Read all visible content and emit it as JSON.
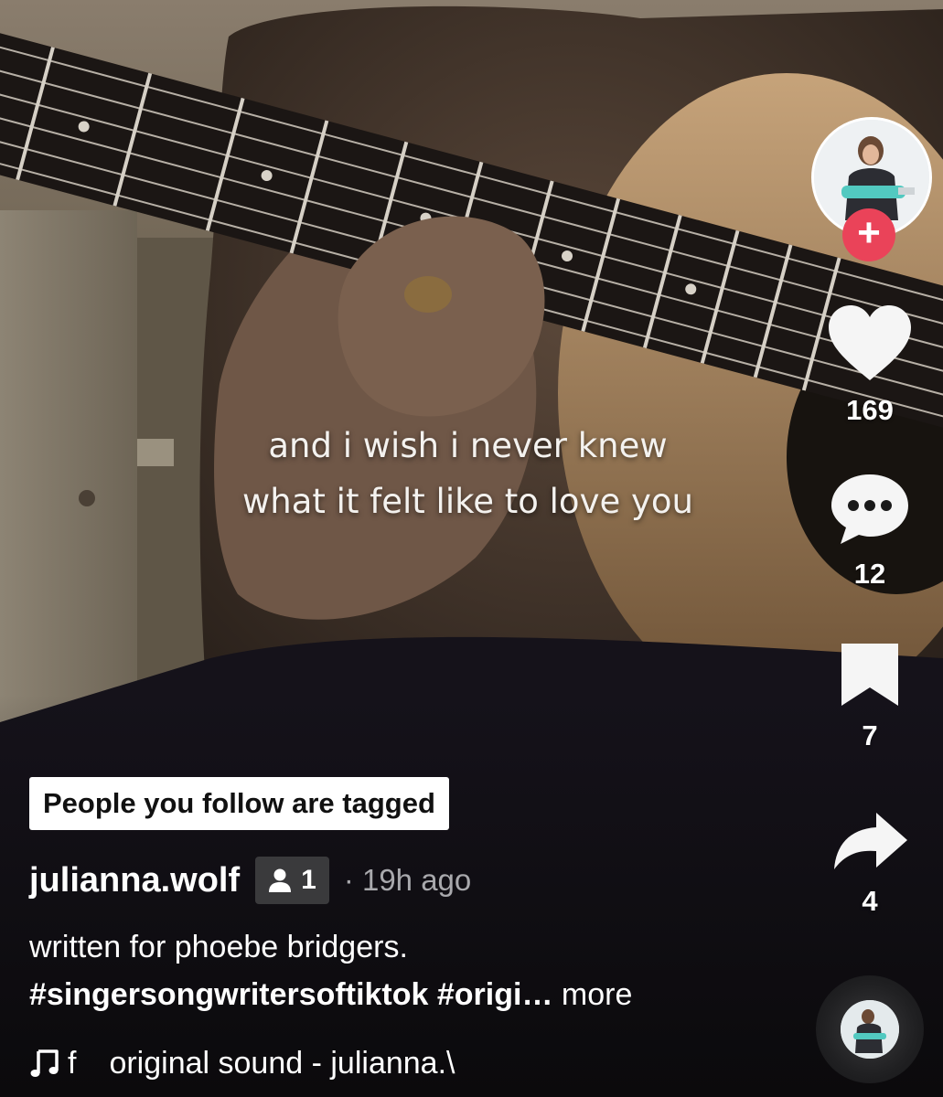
{
  "lyrics": {
    "line1": "and i wish i never knew",
    "line2": "what it felt like to love you"
  },
  "creator": {
    "username": "julianna.wolf",
    "avatar_icon": "profile-avatar",
    "follow_icon": "plus-icon",
    "follow_symbol": "+"
  },
  "actions": {
    "likes": "169",
    "comments": "12",
    "saves": "7",
    "shares": "4"
  },
  "post": {
    "tag_notice": "People you follow are tagged",
    "tagged_count": "1",
    "time": "· 19h ago",
    "caption": "written for phoebe bridgers.",
    "hashtags": "#singersongwritersoftiktok #origi…",
    "more_label": " more"
  },
  "sound": {
    "fragment": "f",
    "title": "original sound - julianna.\\"
  },
  "colors": {
    "follow_red": "#ea4359",
    "badge_bg": "#3a3a3c",
    "time_gray": "#a9a9ad"
  }
}
